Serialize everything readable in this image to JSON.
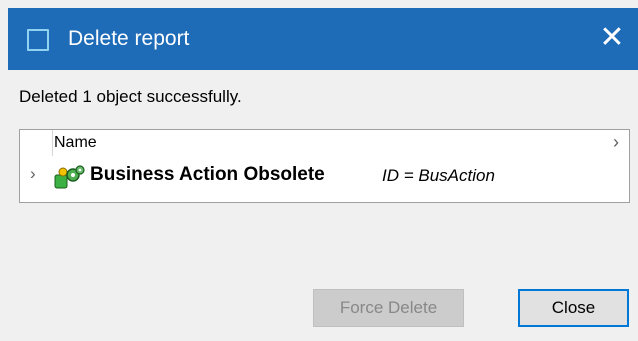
{
  "window": {
    "title": "Delete report",
    "close_glyph": "✕"
  },
  "message": "Deleted 1 object successfully.",
  "tree": {
    "columns": [
      {
        "label": "Name"
      }
    ],
    "header_chevron": "›",
    "rows": [
      {
        "expander": "›",
        "icon": "business-action-icon",
        "name": "Business Action Obsolete",
        "id_text": "ID = BusAction"
      }
    ]
  },
  "buttons": {
    "force_delete": "Force Delete",
    "close": "Close"
  },
  "colors": {
    "titlebar": "#1e6bb8",
    "close_border": "#0078d7"
  }
}
